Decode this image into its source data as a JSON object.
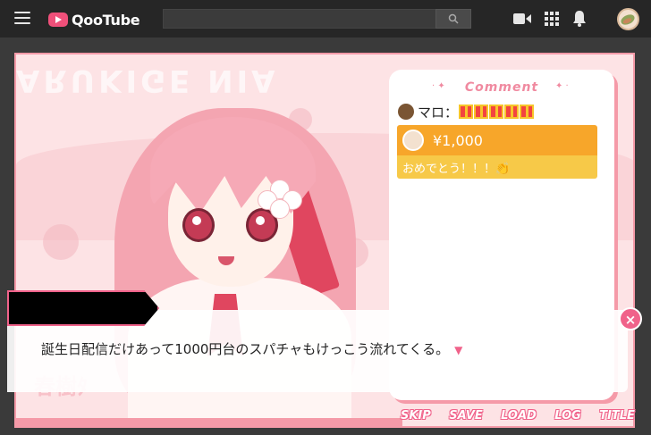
{
  "header": {
    "logo_text": "QooTube",
    "search_placeholder": ""
  },
  "video": {
    "bg_title": "ARUKIGE NIA",
    "stream_logo": "春樹ﾀ"
  },
  "comments": {
    "title": "Comment",
    "row1_name": "マロ：",
    "superchat": {
      "amount": "¥1,000",
      "message": "おめでとう！！！👏"
    }
  },
  "dialogue": {
    "speaker": "",
    "text": "誕生日配信だけあって1000円台のスパチャもけっこう流れてくる。",
    "arrow": "▼"
  },
  "controls": [
    "SKIP",
    "SAVE",
    "LOAD",
    "LOG",
    "TITLE"
  ],
  "close_label": "×"
}
